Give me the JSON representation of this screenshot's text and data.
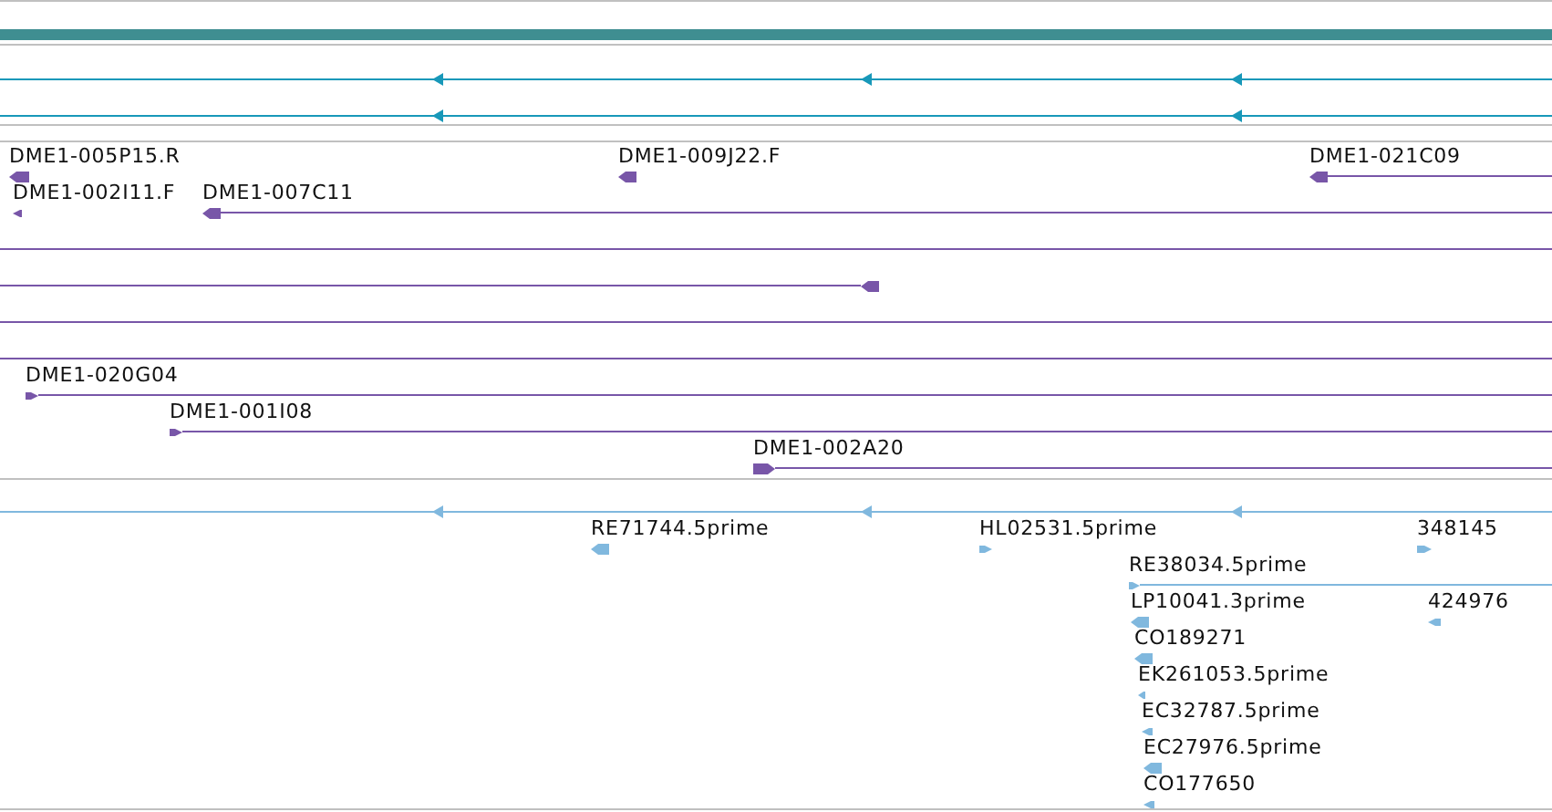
{
  "tracks": [
    {
      "kind": "bar"
    },
    {
      "kind": "lines"
    },
    {
      "kind": "features",
      "features": [
        {
          "label": "DME1-005P15.R",
          "reverse": true
        },
        {
          "label": "DME1-009J22.F",
          "reverse": true
        },
        {
          "label": "DME1-021C09",
          "reverse": true
        },
        {
          "label": "DME1-002I11.F",
          "reverse": true
        },
        {
          "label": "DME1-007C11",
          "reverse": true
        },
        {
          "label": "DME1-020G04",
          "reverse": false
        },
        {
          "label": "DME1-001I08",
          "reverse": false
        },
        {
          "label": "DME1-002A20",
          "reverse": false
        }
      ]
    },
    {
      "kind": "features",
      "features": [
        {
          "label": "RE71744.5prime",
          "reverse": true
        },
        {
          "label": "HL02531.5prime",
          "reverse": false
        },
        {
          "label": "348145",
          "reverse": false
        },
        {
          "label": "RE38034.5prime",
          "reverse": false
        },
        {
          "label": "LP10041.3prime",
          "reverse": true
        },
        {
          "label": "424976",
          "reverse": true
        },
        {
          "label": "CO189271",
          "reverse": true
        },
        {
          "label": "EK261053.5prime",
          "reverse": true
        },
        {
          "label": "EC32787.5prime",
          "reverse": true
        },
        {
          "label": "EC27976.5prime",
          "reverse": true
        },
        {
          "label": "CO177650",
          "reverse": true
        }
      ]
    }
  ]
}
